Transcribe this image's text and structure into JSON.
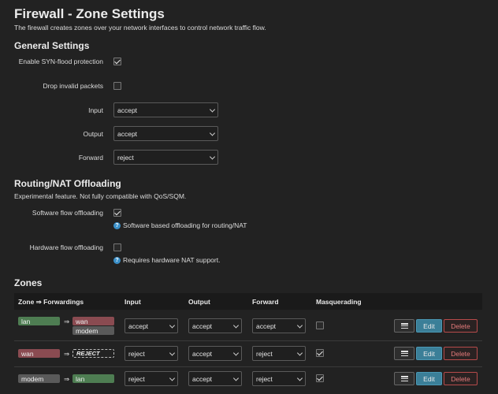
{
  "page": {
    "title": "Firewall - Zone Settings",
    "description": "The firewall creates zones over your network interfaces to control network traffic flow."
  },
  "general": {
    "heading": "General Settings",
    "syn_flood": {
      "label": "Enable SYN-flood protection",
      "checked": true
    },
    "drop_invalid": {
      "label": "Drop invalid packets",
      "checked": false
    },
    "input": {
      "label": "Input",
      "value": "accept"
    },
    "output": {
      "label": "Output",
      "value": "accept"
    },
    "forward": {
      "label": "Forward",
      "value": "reject"
    }
  },
  "offloading": {
    "heading": "Routing/NAT Offloading",
    "description": "Experimental feature. Not fully compatible with QoS/SQM.",
    "software": {
      "label": "Software flow offloading",
      "checked": true,
      "hint": "Software based offloading for routing/NAT"
    },
    "hardware": {
      "label": "Hardware flow offloading",
      "checked": false,
      "hint": "Requires hardware NAT support."
    }
  },
  "zones": {
    "heading": "Zones",
    "columns": {
      "zone": "Zone ⇒ Forwardings",
      "input": "Input",
      "output": "Output",
      "forward": "Forward",
      "masquerading": "Masquerading"
    },
    "arrow": "⇒",
    "buttons": {
      "menu": "☰",
      "edit": "Edit",
      "delete": "Delete"
    },
    "rows": [
      {
        "zone": "lan",
        "forwardings": [
          "wan",
          "modem"
        ],
        "input": "accept",
        "output": "accept",
        "forward": "accept",
        "masquerading": false
      },
      {
        "zone": "wan",
        "forwardings": [
          "REJECT"
        ],
        "input": "reject",
        "output": "accept",
        "forward": "reject",
        "masquerading": true
      },
      {
        "zone": "modem",
        "forwardings": [
          "lan"
        ],
        "input": "reject",
        "output": "accept",
        "forward": "reject",
        "masquerading": true
      }
    ]
  },
  "colors": {
    "zone_lan": "#4e7d52",
    "zone_wan": "#8a4b51",
    "zone_modem": "#5a5a5a",
    "edit_button": "#3b7f98",
    "delete_border": "#b74b4b"
  }
}
